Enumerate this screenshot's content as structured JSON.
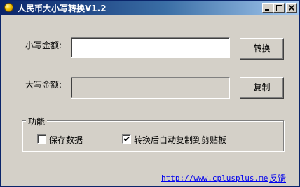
{
  "window": {
    "title": "人民币大小写转换V1.2"
  },
  "form": {
    "lower_label": "小写金额:",
    "lower_value": "",
    "upper_label": "大写金额:",
    "upper_value": "",
    "convert_button": "转换",
    "copy_button": "复制"
  },
  "features": {
    "group_title": "功能",
    "save_data_label": "保存数据",
    "save_data_checked": false,
    "auto_copy_label": "转换后自动复制到剪贴板",
    "auto_copy_checked": true
  },
  "footer": {
    "website_link": "http://www.cplusplus.me",
    "feedback_link": "反馈"
  },
  "colors": {
    "titlebar_start": "#0a246a",
    "titlebar_end": "#a6caf0",
    "face": "#d4d0c8",
    "link": "#0000ee"
  }
}
